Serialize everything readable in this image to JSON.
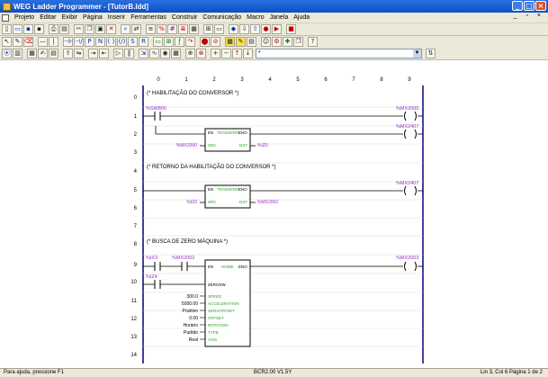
{
  "window": {
    "title": "WEG Ladder Programmer - [TutorB.ldd]"
  },
  "menu": [
    "Projeto",
    "Editar",
    "Exibir",
    "Página",
    "Inserir",
    "Ferramentas",
    "Construir",
    "Comunicação",
    "Macro",
    "Janela",
    "Ajuda"
  ],
  "toolbar": {
    "combo_value": "*"
  },
  "columns": [
    "0",
    "1",
    "2",
    "3",
    "4",
    "5",
    "6",
    "7",
    "8",
    "9"
  ],
  "rows": [
    "0",
    "1",
    "2",
    "3",
    "4",
    "5",
    "6",
    "7",
    "8",
    "9",
    "10",
    "11",
    "12",
    "13",
    "14"
  ],
  "ladder": {
    "comment1": "(* HABILITAÇÃO DO CONVERSOR *)",
    "comment2": "(* RETORNO DA HABILITAÇÃO DO CONVERSOR *)",
    "comment3": "(* BUSCA DE ZERO MÁQUINA *)",
    "r1_contact": "%SW800",
    "r1_coil": "%MX2000",
    "r2_coil": "%MX2407",
    "b1": {
      "en": "EN",
      "name": "TRANSFER",
      "eno": "ENO",
      "src": "SRC",
      "dst": "DST",
      "src_var": "%MX2000",
      "dst_var": "%IZ0"
    },
    "r5_coil": "%MX2407",
    "b2": {
      "en": "EN",
      "name": "TRANSFER",
      "eno": "ENO",
      "src": "SRC",
      "dst": "DST",
      "src_var": "%IZ0",
      "dst_var": "%MX2002"
    },
    "r9_c1": "%IX3",
    "r9_c2": "%MX2002",
    "r9_coil": "%MX2003",
    "r10_c1": "%IZ4",
    "b3": {
      "en": "EN",
      "name": "HOME",
      "eno": "ENO",
      "title": "ZEROSW",
      "inputs": [
        "SPEED",
        "ACCELERATION",
        "SERVOFFSET",
        "OFFSET",
        "ROTATION",
        "TYPE",
        "AXIS"
      ],
      "values": [
        "300.0",
        "5000.00",
        "Positivo",
        "0.00",
        "Horário",
        "Padrão",
        "Real"
      ]
    }
  },
  "status": {
    "left": "Para ajuda, pressione F1",
    "mid": "BCR2.00 V1.5Y",
    "right": "Lin 3, Col 6     Página 1 de 2"
  },
  "colors": {
    "title_blue": "#0d4fc6",
    "rail": "#000080",
    "var_purple": "#9a2fc4",
    "pin_green": "#2aa02a"
  }
}
